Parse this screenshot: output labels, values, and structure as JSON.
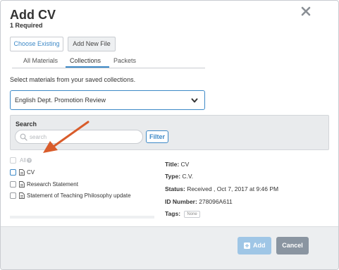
{
  "dialog": {
    "title": "Add CV",
    "required": "1 Required"
  },
  "source_tabs": [
    {
      "label": "Choose Existing",
      "active": true
    },
    {
      "label": "Add New File",
      "active": false
    }
  ],
  "material_tabs": [
    {
      "label": "All Materials",
      "active": false
    },
    {
      "label": "Collections",
      "active": true
    },
    {
      "label": "Packets",
      "active": false
    }
  ],
  "instructions": "Select materials from your saved collections.",
  "collection_select": {
    "value": "English Dept. Promotion Review"
  },
  "search": {
    "label": "Search",
    "placeholder": "search",
    "value": "",
    "filter_label": "Filter"
  },
  "materials": {
    "all_label": "All",
    "items": [
      {
        "label": "CV"
      },
      {
        "label": "Research Statement"
      },
      {
        "label": "Statement of Teaching Philosophy update"
      }
    ]
  },
  "details": {
    "title_label": "Title:",
    "title_value": "CV",
    "type_label": "Type:",
    "type_value": "C.V.",
    "status_label": "Status:",
    "status_value": "Received , Oct 7, 2017 at 9:46 PM",
    "id_label": "ID Number:",
    "id_value": "278096A611",
    "tags_label": "Tags:",
    "tags_value": "None"
  },
  "footer": {
    "add_label": "Add",
    "cancel_label": "Cancel"
  },
  "colors": {
    "accent": "#3d89c7",
    "annotation_arrow": "#d95c2b",
    "add_disabled": "#9fc6e6",
    "cancel": "#8a95a1"
  },
  "icons": {
    "close": "close-icon",
    "dropdown": "chevron-down-icon",
    "search": "search-icon",
    "help": "help-icon",
    "document": "document-icon",
    "add": "plus-icon"
  }
}
